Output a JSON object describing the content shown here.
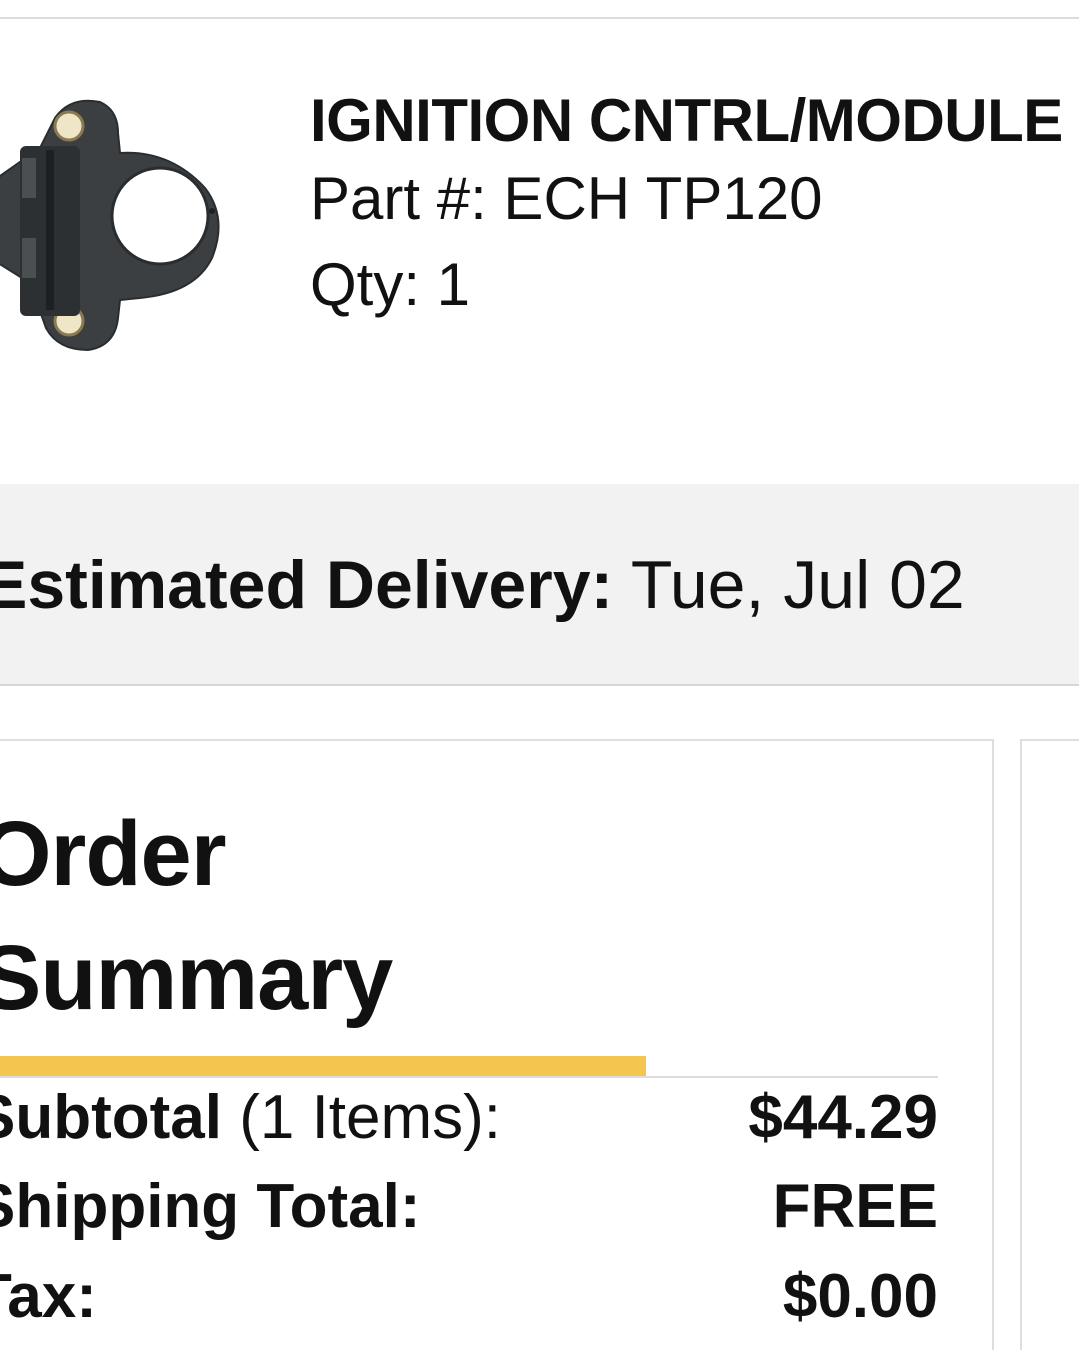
{
  "product": {
    "name": "IGNITION CNTRL/MODULE",
    "part_number": "Part #: ECH TP120",
    "quantity": "Qty: 1",
    "image_icon": "ignition-module-image"
  },
  "delivery": {
    "label": "Estimated Delivery:",
    "date": " Tue, Jul 02"
  },
  "order_summary": {
    "title_line1": "Order",
    "title_line2": "Summary",
    "accent_color": "#f4c64f",
    "subtotal": {
      "label": "Subtotal",
      "count": " (1 Items):",
      "value": "$44.29"
    },
    "shipping": {
      "label": "Shipping Total:",
      "value": "FREE"
    },
    "tax": {
      "label": "Tax:",
      "value": "$0.00"
    }
  }
}
